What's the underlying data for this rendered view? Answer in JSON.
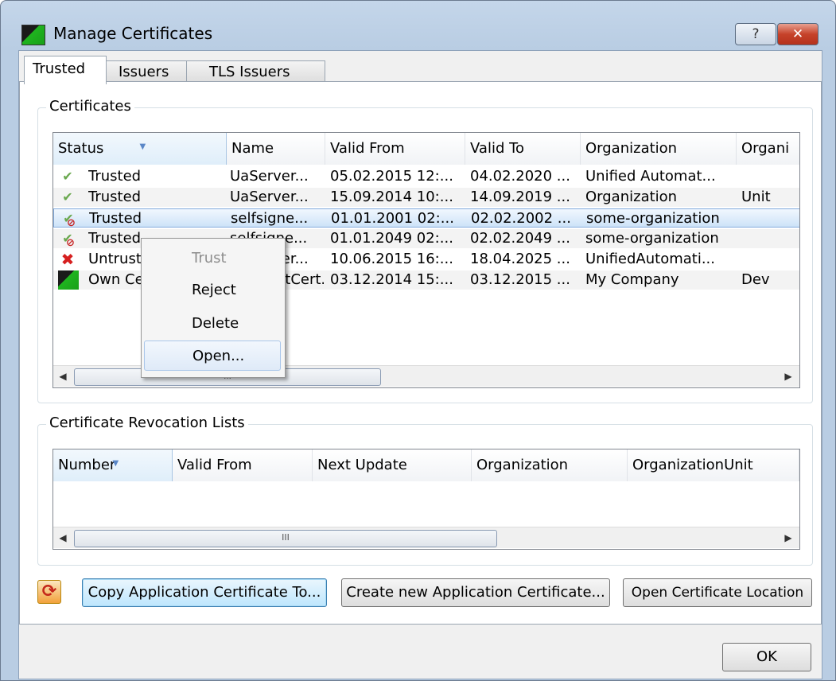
{
  "window": {
    "title": "Manage Certificates",
    "help_label": "?",
    "close_label": "✕"
  },
  "tabs": [
    {
      "label": "Trusted"
    },
    {
      "label": "Issuers"
    },
    {
      "label": "TLS Issuers"
    }
  ],
  "certificates": {
    "group_label": "Certificates",
    "columns": [
      "Status",
      "Name",
      "Valid From",
      "Valid To",
      "Organization",
      "Organi"
    ],
    "rows": [
      {
        "icon": "check-icon",
        "status": "Trusted",
        "name": "UaServer...",
        "valid_from": "05.02.2015 12:...",
        "valid_to": "04.02.2020 ...",
        "org": "Unified Automat...",
        "orgunit": ""
      },
      {
        "icon": "check-icon",
        "status": "Trusted",
        "name": "UaServer...",
        "valid_from": "15.09.2014 10:...",
        "valid_to": "14.09.2019 ...",
        "org": "Organization",
        "orgunit": "Unit"
      },
      {
        "icon": "check-forbidden-icon",
        "status": "Trusted",
        "name": "selfsigne...",
        "valid_from": "01.01.2001 02:...",
        "valid_to": "02.02.2002 ...",
        "org": "some-organization",
        "orgunit": ""
      },
      {
        "icon": "check-forbidden-icon",
        "status": "Trusted",
        "name": "selfsigne...",
        "valid_from": "01.01.2049 02:...",
        "valid_to": "02.02.2049 ...",
        "org": "some-organization",
        "orgunit": ""
      },
      {
        "icon": "red-x-icon",
        "status": "Untrusted",
        "name": "UaServer...",
        "valid_from": "10.06.2015 16:...",
        "valid_to": "18.04.2025 ...",
        "org": "UnifiedAutomati...",
        "orgunit": ""
      },
      {
        "icon": "own-certificate-icon",
        "status": "Own Certificate",
        "name": "UaClientCert...",
        "valid_from": "03.12.2014 15:...",
        "valid_to": "03.12.2015 ...",
        "org": "My Company",
        "orgunit": "Dev"
      }
    ],
    "scroll_grip": "III"
  },
  "context_menu": {
    "items": [
      {
        "label": "Trust",
        "enabled": false
      },
      {
        "label": "Reject",
        "enabled": true
      },
      {
        "label": "Delete",
        "enabled": true
      },
      {
        "label": "Open...",
        "enabled": true
      }
    ]
  },
  "crl": {
    "group_label": "Certificate Revocation Lists",
    "columns": [
      "Number",
      "Valid From",
      "Next Update",
      "Organization",
      "OrganizationUnit"
    ],
    "scroll_grip": "III"
  },
  "buttons": {
    "copy": "Copy Application Certificate To...",
    "create": "Create new Application Certificate...",
    "open_location": "Open Certificate Location",
    "ok": "OK"
  }
}
